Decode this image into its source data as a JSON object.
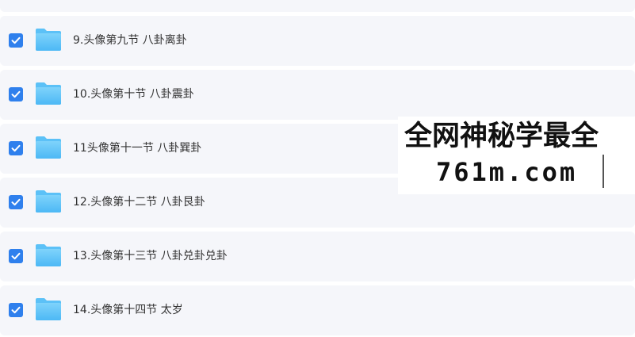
{
  "file_list": {
    "items": [
      {
        "label": "",
        "checked": true
      },
      {
        "label": "9.头像第九节 八卦离卦",
        "checked": true
      },
      {
        "label": "10.头像第十节 八卦震卦",
        "checked": true
      },
      {
        "label": "11头像第十一节 八卦巽卦",
        "checked": true
      },
      {
        "label": "12.头像第十二节 八卦艮卦",
        "checked": true
      },
      {
        "label": "13.头像第十三节 八卦兑卦兑卦",
        "checked": true
      },
      {
        "label": "14.头像第十四节 太岁",
        "checked": true
      }
    ]
  },
  "watermark": {
    "line1": "全网神秘学最全",
    "line2": "761m.com"
  },
  "colors": {
    "checkbox": "#2f80ed",
    "folder_top": "#7fd3fb",
    "folder_bottom": "#4cb8f5",
    "row_background": "#f5f6fa"
  },
  "icons": {
    "checkbox": "checkmark-icon",
    "folder": "folder-icon"
  }
}
